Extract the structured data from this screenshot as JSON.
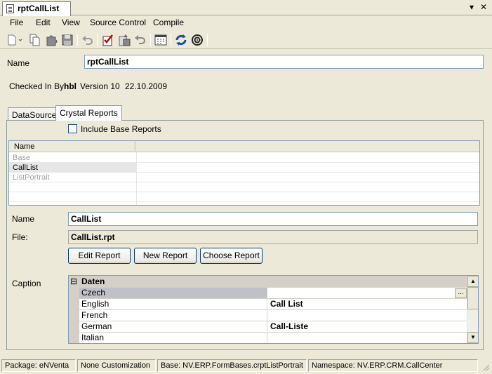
{
  "document_tab": {
    "title": "rptCallList"
  },
  "menu": {
    "items": [
      "File",
      "Edit",
      "View",
      "Source Control",
      "Compile"
    ]
  },
  "toolbar": {
    "buttons": [
      "new-icon",
      "copy-icon",
      "puzzle-icon",
      "save-icon",
      "undo-icon",
      "checkin-icon",
      "checkout-icon",
      "revert-icon",
      "calendar-icon",
      "refresh-icon",
      "settings-icon"
    ]
  },
  "header": {
    "name_label": "Name",
    "name_value": "rptCallList",
    "checked_in_label": "Checked In By",
    "checked_in_user": "hbl",
    "version": "Version 10",
    "date": "22.10.2009"
  },
  "tabs": [
    "DataSource",
    "Crystal Reports"
  ],
  "crystal": {
    "include_base_label": "Include Base Reports",
    "list_header": "Name",
    "list_items": [
      "Base",
      "CallList",
      "ListPortrait"
    ],
    "name_label": "Name",
    "name_value": "CallList",
    "file_label": "File:",
    "file_value": "CallList.rpt",
    "edit_report": "Edit Report",
    "new_report": "New Report",
    "choose_report": "Choose Report",
    "caption_label": "Caption",
    "grid": {
      "category_toggle": "⊟",
      "category": "Daten",
      "rows": [
        {
          "name": "Czech",
          "value": ""
        },
        {
          "name": "English",
          "value": "Call List"
        },
        {
          "name": "French",
          "value": ""
        },
        {
          "name": "German",
          "value": "Call-Liste"
        },
        {
          "name": "Italian",
          "value": ""
        }
      ],
      "ellipsis": "..."
    }
  },
  "status": {
    "package": "Package: eNVenta",
    "customization": "None Customization",
    "base": "Base: NV.ERP.FormBases.crptListPortrait",
    "namespace": "Namespace: NV.ERP.CRM.CallCenter"
  }
}
